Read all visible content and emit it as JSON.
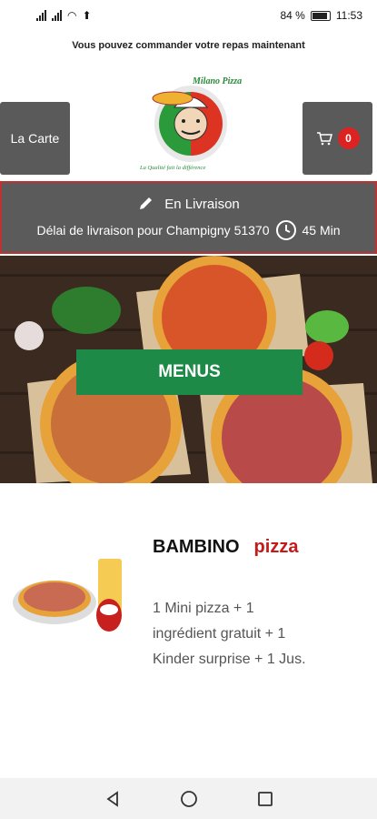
{
  "status": {
    "battery": "84 %",
    "time": "11:53"
  },
  "banner": "Vous pouvez commander votre repas maintenant",
  "header": {
    "left_button": "La Carte",
    "cart_count": "0",
    "logo_text_top": "Milano Pizza",
    "logo_text_bottom": "La Qualité fait la différence"
  },
  "delivery": {
    "mode": "En Livraison",
    "info": "Délai de livraison pour Champigny 51370",
    "time": "45 Min"
  },
  "hero": {
    "menus_button": "MENUS"
  },
  "product": {
    "title": "BAMBINO",
    "subtitle": "pizza",
    "description": "1 Mini pizza + 1 ingrédient gratuit + 1 Kinder surprise + 1 Jus."
  },
  "icons": {
    "pencil": "pencil-icon",
    "clock": "clock-icon",
    "cart": "cart-icon"
  }
}
